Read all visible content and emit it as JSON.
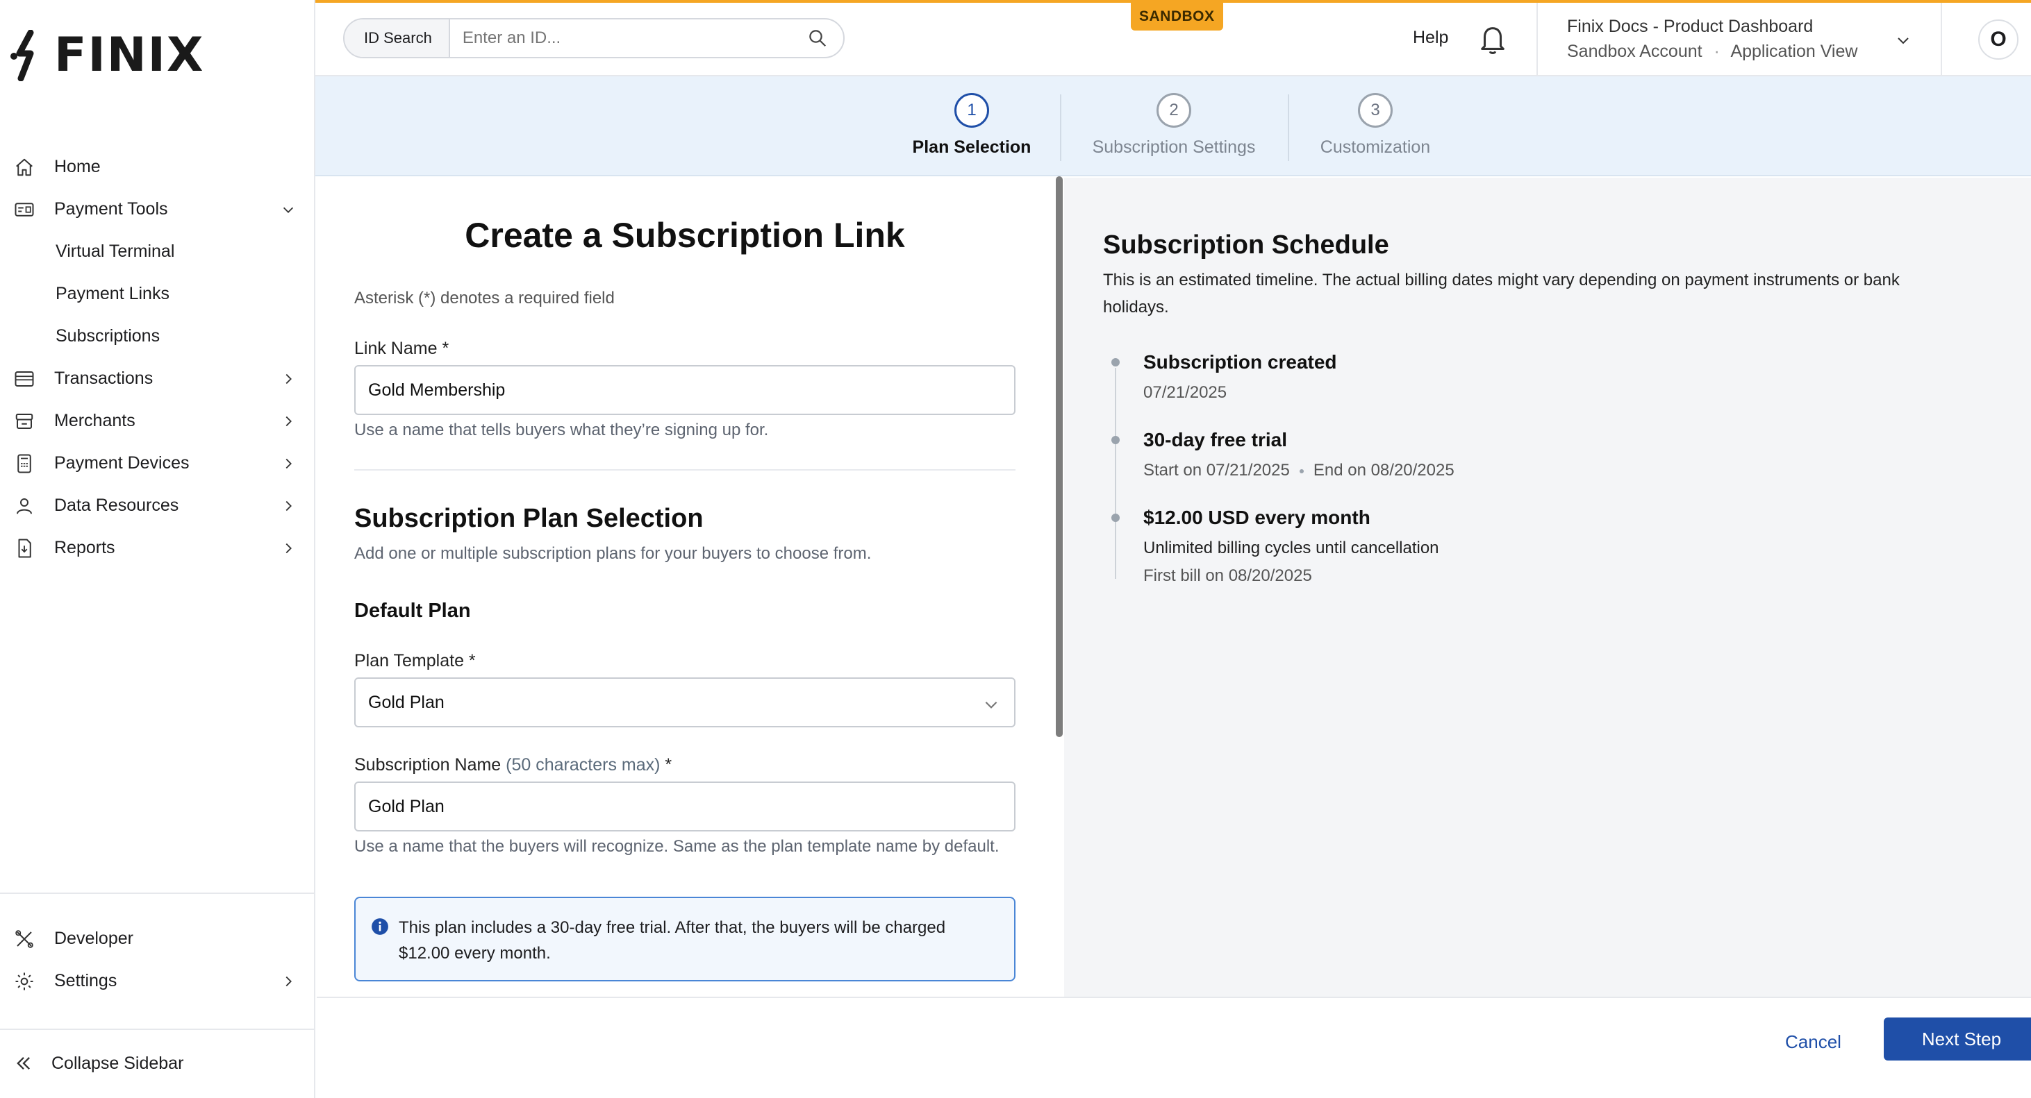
{
  "brand": {
    "name": "FINIX",
    "accent": "#1f4fa8",
    "sandbox_color": "#f5a623"
  },
  "sidebar": {
    "items": [
      {
        "label": "Home",
        "icon": "home-icon"
      },
      {
        "label": "Payment Tools",
        "icon": "payment-tools-icon",
        "expanded": true
      },
      {
        "label": "Virtual Terminal"
      },
      {
        "label": "Payment Links"
      },
      {
        "label": "Subscriptions"
      },
      {
        "label": "Transactions",
        "icon": "transactions-icon"
      },
      {
        "label": "Merchants",
        "icon": "merchants-icon"
      },
      {
        "label": "Payment Devices",
        "icon": "payment-devices-icon"
      },
      {
        "label": "Data Resources",
        "icon": "data-resources-icon"
      },
      {
        "label": "Reports",
        "icon": "reports-icon"
      }
    ],
    "bottom": [
      {
        "label": "Developer",
        "icon": "developer-icon"
      },
      {
        "label": "Settings",
        "icon": "gear-icon"
      }
    ],
    "collapse_label": "Collapse Sidebar"
  },
  "header": {
    "id_search_label": "ID Search",
    "id_search_placeholder": "Enter an ID...",
    "sandbox_badge": "SANDBOX",
    "help": "Help",
    "account_line1": "Finix Docs - Product Dashboard",
    "account_line2_a": "Sandbox Account",
    "account_line2_sep": "·",
    "account_line2_b": "Application View",
    "avatar_initial": "O"
  },
  "stepper": {
    "steps": [
      {
        "number": "1",
        "label": "Plan Selection",
        "active": true
      },
      {
        "number": "2",
        "label": "Subscription Settings",
        "active": false
      },
      {
        "number": "3",
        "label": "Customization",
        "active": false
      }
    ]
  },
  "form": {
    "title": "Create a Subscription Link",
    "required_note": "Asterisk (*) denotes a required field",
    "link_name_label": "Link Name *",
    "link_name_value": "Gold Membership",
    "link_name_help": "Use a name that tells buyers what they’re signing up for.",
    "plan_section_title": "Subscription Plan Selection",
    "plan_section_desc": "Add one or multiple subscription plans for your buyers to choose from.",
    "default_plan_title": "Default Plan",
    "plan_template_label": "Plan Template *",
    "plan_template_value": "Gold Plan",
    "subscription_name_label": "Subscription Name",
    "subscription_name_hint": "(50 characters max)",
    "subscription_name_required": "*",
    "subscription_name_value": "Gold Plan",
    "subscription_name_help": "Use a name that the buyers will recognize. Same as the plan template name by default.",
    "info_text": "This plan includes a 30-day free trial. After that, the buyers will be charged $12.00 every month."
  },
  "schedule": {
    "title": "Subscription Schedule",
    "description": "This is an estimated timeline. The actual billing dates might vary depending on payment instruments or bank holidays.",
    "events": [
      {
        "title": "Subscription created",
        "line1": "07/21/2025"
      },
      {
        "title": "30-day free trial",
        "line1_a": "Start on 07/21/2025",
        "line1_b": "End on 08/20/2025"
      },
      {
        "title": "$12.00 USD every month",
        "line1": "Unlimited billing cycles until cancellation",
        "line2": "First bill on 08/20/2025"
      }
    ]
  },
  "footer": {
    "cancel": "Cancel",
    "next": "Next Step"
  }
}
